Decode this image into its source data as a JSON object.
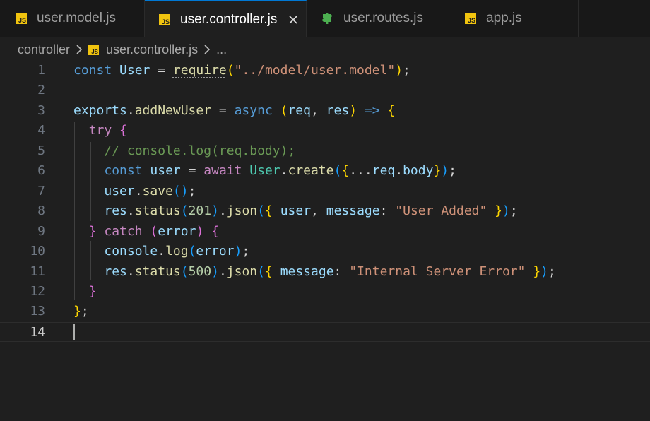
{
  "tabs": [
    {
      "label": "user.model.js",
      "icon": "js-icon"
    },
    {
      "label": "user.controller.js",
      "icon": "js-icon",
      "active": true
    },
    {
      "label": "user.routes.js",
      "icon": "routes-icon"
    },
    {
      "label": "app.js",
      "icon": "js-icon"
    }
  ],
  "js_badge": "JS",
  "breadcrumb": {
    "folder": "controller",
    "file": "user.controller.js",
    "more": "..."
  },
  "line_numbers": [
    "1",
    "2",
    "3",
    "4",
    "5",
    "6",
    "7",
    "8",
    "9",
    "10",
    "11",
    "12",
    "13",
    "14"
  ],
  "code": {
    "l1": {
      "kw": "const",
      "var": "User",
      "eq": " = ",
      "fn": "require",
      "open": "(",
      "str": "\"../model/user.model\"",
      "close": ")",
      "end": ";"
    },
    "l3": {
      "obj": "exports",
      "dot": ".",
      "fn": "addNewUser",
      "eq": " = ",
      "kw": "async",
      "open": "(",
      "p1": "req",
      "comma": ", ",
      "p2": "res",
      "close": ")",
      "arrow": "=>",
      "brace": "{"
    },
    "l4": {
      "kw": "try",
      "brace": "{"
    },
    "l5": {
      "comment": "// console.log(req.body);"
    },
    "l6": {
      "kw": "const",
      "var": "user",
      "eq": " = ",
      "await": "await",
      "cls": "User",
      "dot": ".",
      "fn": "create",
      "open": "(",
      "ob": "{",
      "spread": "...",
      "obj": "req",
      "dot2": ".",
      "prop": "body",
      "cb": "}",
      "close": ")",
      "end": ";"
    },
    "l7": {
      "var": "user",
      "dot": ".",
      "fn": "save",
      "parens": "()",
      "end": ";"
    },
    "l8": {
      "obj": "res",
      "dot": ".",
      "fn": "status",
      "open": "(",
      "num": "201",
      "close": ")",
      "dot2": ".",
      "fn2": "json",
      "open2": "(",
      "ob": "{",
      "v1": "user",
      "comma": ", ",
      "key": "message",
      "colon": ": ",
      "str": "\"User Added\"",
      "cb": "}",
      "close2": ")",
      "end": ";"
    },
    "l9": {
      "cb": "}",
      "kw": "catch",
      "open": "(",
      "var": "error",
      "close": ")",
      "ob": "{"
    },
    "l10": {
      "obj": "console",
      "dot": ".",
      "fn": "log",
      "open": "(",
      "var": "error",
      "close": ")",
      "end": ";"
    },
    "l11": {
      "obj": "res",
      "dot": ".",
      "fn": "status",
      "open": "(",
      "num": "500",
      "close": ")",
      "dot2": ".",
      "fn2": "json",
      "open2": "(",
      "ob": "{",
      "key": "message",
      "colon": ": ",
      "str": "\"Internal Server Error\"",
      "cb": "}",
      "close2": ")",
      "end": ";"
    },
    "l12": {
      "cb": "}"
    },
    "l13": {
      "cb": "}",
      "end": ";"
    }
  },
  "colors": {
    "accent": "#0078d4",
    "js_icon": "#f1c40f",
    "routes_icon": "#4caf50"
  }
}
